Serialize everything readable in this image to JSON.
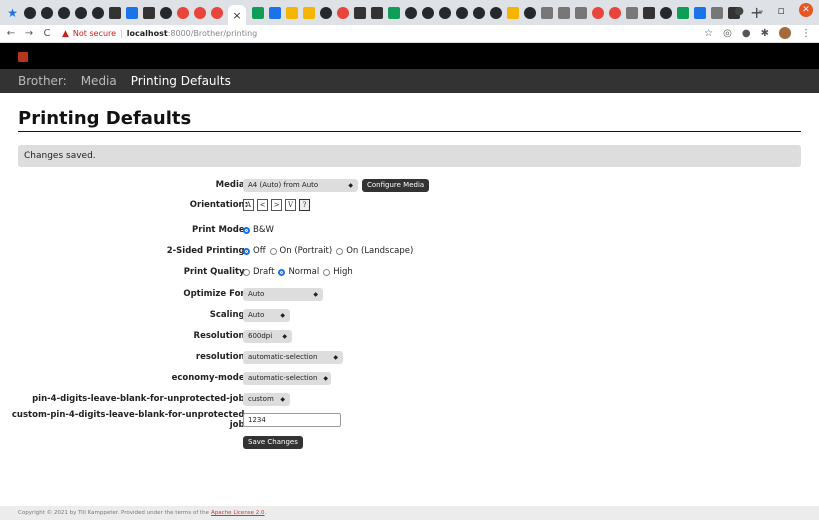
{
  "browser": {
    "tab_icons": [
      "star",
      "gh",
      "gh",
      "gh",
      "gh",
      "gh",
      "drk",
      "blue",
      "drk",
      "gh",
      "red",
      "red",
      "red",
      "active",
      "grn",
      "blue",
      "org",
      "org",
      "gh",
      "red",
      "drk",
      "drk",
      "grn",
      "gh",
      "gh",
      "gh",
      "gh",
      "gh",
      "gh",
      "org",
      "gh",
      "gry",
      "gry",
      "gry",
      "red",
      "red",
      "gry",
      "drk",
      "gh",
      "grn",
      "blue",
      "gry",
      "drk"
    ],
    "active_tab_close": "×",
    "new_tab": "+",
    "address": {
      "security": "Not secure",
      "host": "localhost",
      "path": ":8000/Brother/printing"
    }
  },
  "nav": {
    "items": [
      {
        "label": "Brother:",
        "active": false
      },
      {
        "label": "Media",
        "active": false
      },
      {
        "label": "Printing Defaults",
        "active": true
      }
    ]
  },
  "page": {
    "title": "Printing Defaults",
    "alert": "Changes saved."
  },
  "form": {
    "media": {
      "label": "Media:",
      "value": "A4 (Auto) from Auto",
      "button": "Configure Media"
    },
    "orientation": {
      "label": "Orientation:",
      "options": [
        "A",
        "<",
        ">",
        "V",
        "?"
      ]
    },
    "print_mode": {
      "label": "Print Mode:",
      "options": [
        {
          "label": "B&W",
          "checked": true
        }
      ]
    },
    "sided": {
      "label": "2-Sided Printing:",
      "options": [
        {
          "label": "Off",
          "checked": true
        },
        {
          "label": "On (Portrait)",
          "checked": false
        },
        {
          "label": "On (Landscape)",
          "checked": false
        }
      ]
    },
    "quality": {
      "label": "Print Quality:",
      "options": [
        {
          "label": "Draft",
          "checked": false
        },
        {
          "label": "Normal",
          "checked": true
        },
        {
          "label": "High",
          "checked": false
        }
      ]
    },
    "optimize": {
      "label": "Optimize For:",
      "value": "Auto"
    },
    "scaling": {
      "label": "Scaling:",
      "value": "Auto"
    },
    "resolution": {
      "label": "Resolution:",
      "value": "600dpi"
    },
    "resolution2": {
      "label": "resolution:",
      "value": "automatic-selection"
    },
    "economy": {
      "label": "economy-mode:",
      "value": "automatic-selection"
    },
    "pin": {
      "label": "pin-4-digits-leave-blank-for-unprotected-job:",
      "value": "custom"
    },
    "custom_pin": {
      "label": "custom-pin-4-digits-leave-blank-for-unprotected-job:",
      "value": "1234"
    },
    "save": "Save Changes"
  },
  "footer": {
    "text": "Copyright © 2021 by Till Kamppeter. Provided under the terms of the",
    "link": "Apache License 2.0",
    "tail": "."
  }
}
